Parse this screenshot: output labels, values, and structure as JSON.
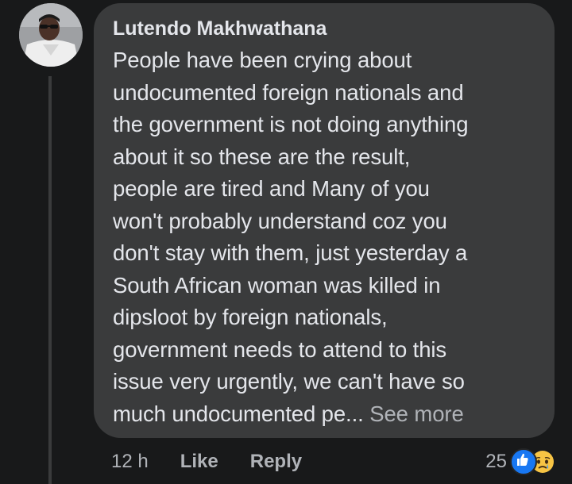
{
  "comment": {
    "author": "Lutendo Makhwathana",
    "lines": [
      "People have been crying about",
      "undocumented foreign nationals and",
      "the government is not doing anything",
      "about it so these are the result,",
      "people are tired and Many of you",
      "won't probably understand coz you",
      "don't stay with them, just yesterday a",
      "South African woman was killed in",
      "dipsloot by foreign nationals,",
      "government needs to attend to this",
      "issue very urgently, we can't have so"
    ],
    "last_line": "much undocumented pe...",
    "see_more": "See more"
  },
  "actions": {
    "time": "12 h",
    "like": "Like",
    "reply": "Reply"
  },
  "reactions": {
    "count": "25",
    "icons": [
      "like-icon",
      "sad-icon"
    ]
  },
  "colors": {
    "background": "#18191a",
    "bubble": "#3a3b3c",
    "text": "#e4e6eb",
    "muted": "#b0b3b8",
    "like_blue": "#1877f2",
    "sad_yellow": "#f7c444"
  }
}
